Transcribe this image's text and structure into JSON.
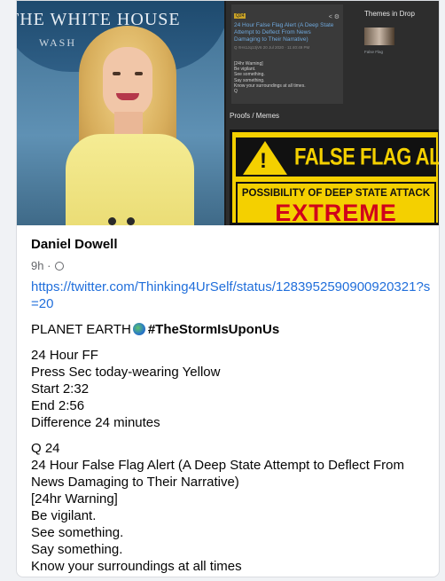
{
  "media": {
    "photo": {
      "sign_text": "THE WHITE HOUSE",
      "sign_text_2": "WASH"
    },
    "screenshot": {
      "badge": "Q24",
      "post_title": "24 Hour False Flag Alert (A Deep State Attempt to Deflect From News Damaging to Their Narrative)",
      "post_meta": "Q !!Hs1Jq13jV6 20 Jul 2020 · 11:40:49 PM",
      "post_body": "[24hr Warning]\nBe vigilant.\nSee something.\nSay something.\nKnow your surroundings at all times.\nQ",
      "themes_title": "Themes in Drop",
      "theme_label": "False Flag",
      "proofs_title": "Proofs / Memes",
      "alert_head": "FALSE FLAG ALERT",
      "alert_bang": "!",
      "alert_sub": "POSSIBILITY OF DEEP STATE ATTACK",
      "alert_level": "EXTREME"
    }
  },
  "post": {
    "author": "Daniel Dowell",
    "time": "9h",
    "sep": "·",
    "link": "https://twitter.com/Thinking4UrSelf/status/1283952590900920321?s=20",
    "line1_prefix": "PLANET EARTH",
    "hashtag": "#TheStormIsUponUs",
    "block2": [
      "24 Hour FF",
      "Press Sec today-wearing Yellow",
      "Start 2:32",
      "End 2:56",
      "Difference 24 minutes"
    ],
    "block3": [
      "Q 24",
      "24 Hour False Flag Alert (A Deep State Attempt to Deflect From",
      "News Damaging to Their Narrative)",
      "[24hr Warning]",
      "Be vigilant.",
      "See something.",
      "Say something.",
      "Know your surroundings at all times"
    ]
  }
}
